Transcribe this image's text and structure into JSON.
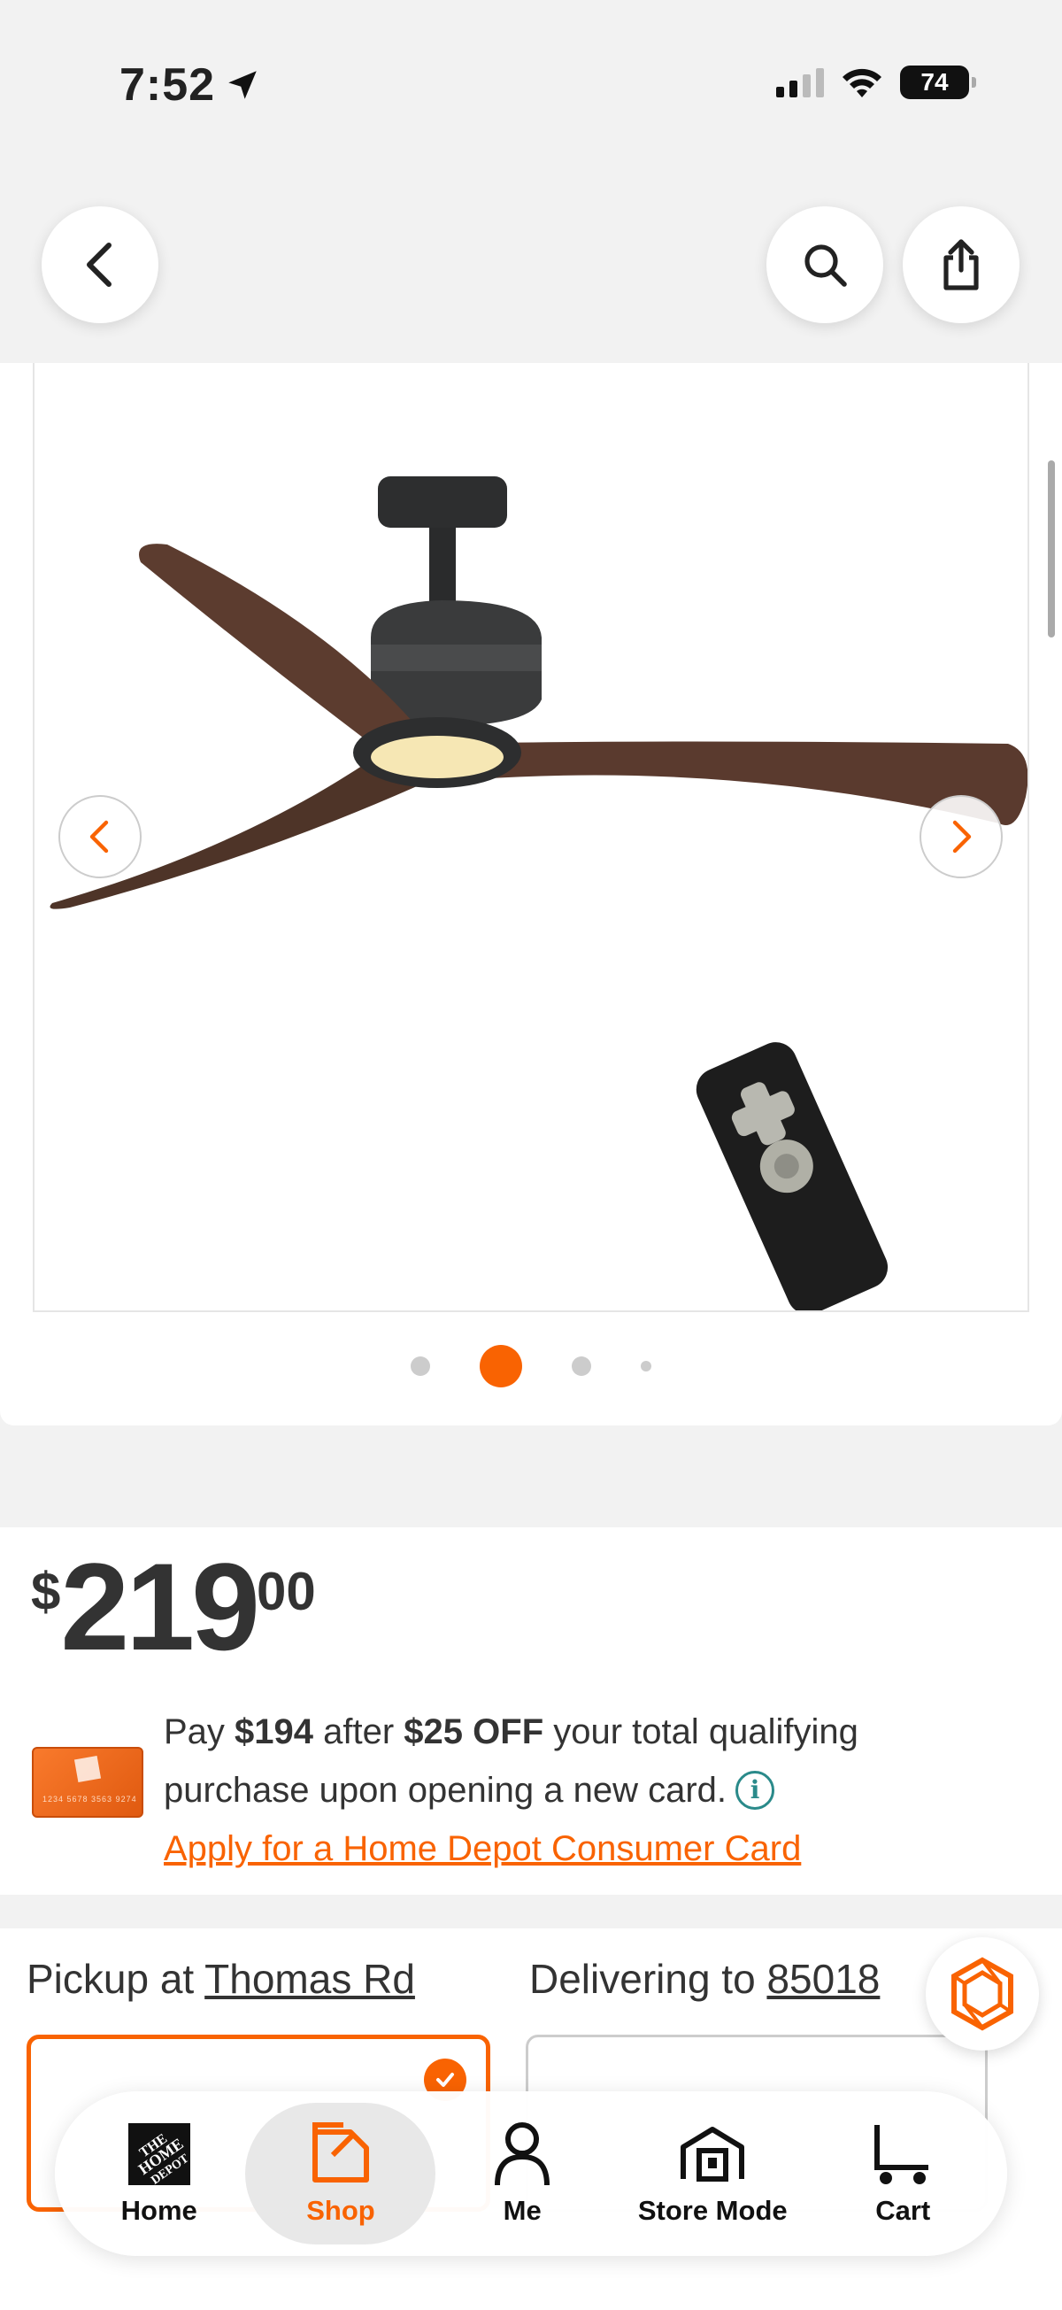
{
  "status_bar": {
    "time": "7:52",
    "battery": "74"
  },
  "product": {
    "image_alt": "Ceiling fan with dark wood blades, LED light and remote control",
    "carousel": {
      "total": 4,
      "active_index": 1
    }
  },
  "price": {
    "currency": "$",
    "dollars": "219",
    "cents": "00"
  },
  "promo": {
    "text_pay": "Pay ",
    "amount_after": "$194",
    "text_after": " after ",
    "discount": "$25 OFF",
    "text_rest": " your total qualifying purchase upon opening a new card.",
    "apply_link": "Apply for a Home Depot Consumer Card",
    "card_number": "1234 5678 3563 9274"
  },
  "fulfillment": {
    "pickup_prefix": "Pickup at ",
    "pickup_store": "Thomas Rd",
    "deliver_prefix": "Delivering to ",
    "deliver_zip": "85018"
  },
  "tab_bar": {
    "tabs": [
      {
        "label": "Home",
        "icon": "home-depot-logo-icon"
      },
      {
        "label": "Shop",
        "icon": "shop-icon"
      },
      {
        "label": "Me",
        "icon": "person-icon"
      },
      {
        "label": "Store Mode",
        "icon": "store-icon"
      },
      {
        "label": "Cart",
        "icon": "cart-icon"
      }
    ],
    "active": "Shop"
  },
  "colors": {
    "accent": "#f96302",
    "info": "#2a8a8a"
  }
}
